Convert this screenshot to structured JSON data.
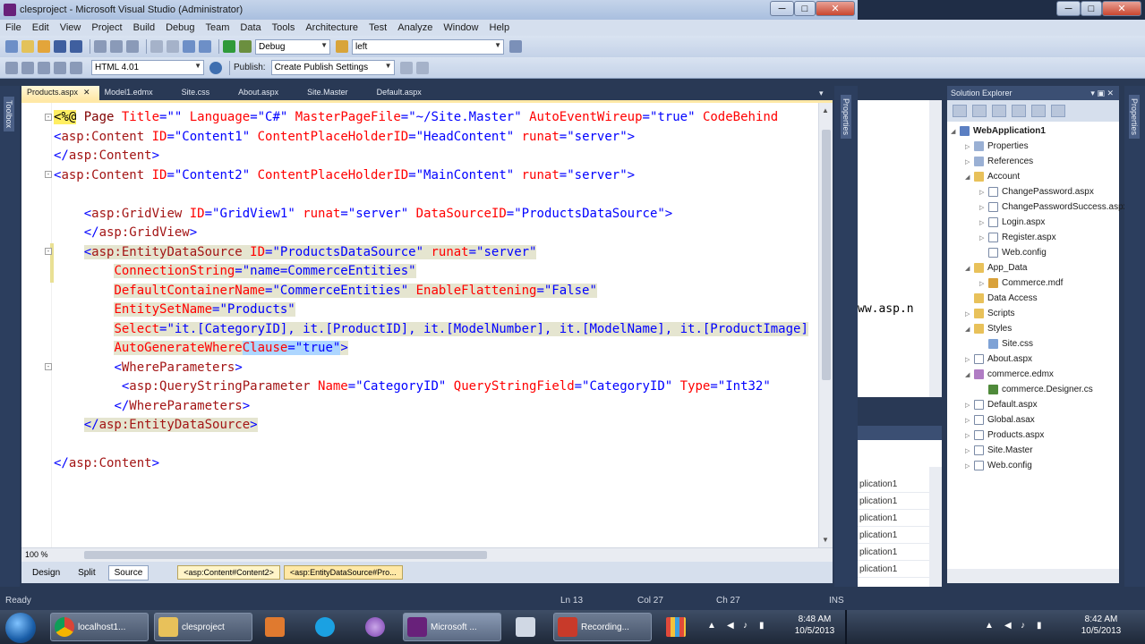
{
  "window": {
    "title": "clesproject - Microsoft Visual Studio (Administrator)",
    "min": "─",
    "max": "□",
    "close": "✕"
  },
  "menu": [
    "File",
    "Edit",
    "View",
    "Project",
    "Build",
    "Debug",
    "Team",
    "Data",
    "Tools",
    "Architecture",
    "Test",
    "Analyze",
    "Window",
    "Help"
  ],
  "toolbar1": {
    "config": "Debug",
    "find": "left"
  },
  "toolbar2": {
    "schema": "HTML 4.01",
    "publish_label": "Publish:",
    "publish_settings": "Create Publish Settings"
  },
  "toolbox_label": "Toolbox",
  "properties_label": "Properties",
  "right_properties_label": "Properties",
  "tabs": [
    {
      "label": "Products.aspx",
      "active": true
    },
    {
      "label": "Model1.edmx"
    },
    {
      "label": "Site.css"
    },
    {
      "label": "About.aspx"
    },
    {
      "label": "Site.Master"
    },
    {
      "label": "Default.aspx"
    }
  ],
  "tab_close": "✕",
  "code_lines": [
    [
      [
        "dir",
        "<%@"
      ],
      [
        "tag",
        " Page "
      ],
      [
        "attr",
        "Title"
      ],
      [
        "blue",
        "=\"\" "
      ],
      [
        "attr",
        "Language"
      ],
      [
        "blue",
        "=\"C#\" "
      ],
      [
        "attr",
        "MasterPageFile"
      ],
      [
        "blue",
        "=\"~/Site.Master\" "
      ],
      [
        "attr",
        "AutoEventWireup"
      ],
      [
        "blue",
        "=\"true\" "
      ],
      [
        "attr",
        "CodeBehind"
      ]
    ],
    [
      [
        "blue",
        "<"
      ],
      [
        "asp",
        "asp:Content"
      ],
      [
        "attr",
        " ID"
      ],
      [
        "blue",
        "=\"Content1\" "
      ],
      [
        "attr",
        "ContentPlaceHolderID"
      ],
      [
        "blue",
        "=\"HeadContent\" "
      ],
      [
        "attr",
        "runat"
      ],
      [
        "blue",
        "=\"server\">"
      ]
    ],
    [
      [
        "blue",
        "</"
      ],
      [
        "asp",
        "asp:Content"
      ],
      [
        "blue",
        ">"
      ]
    ],
    [
      [
        "blue",
        "<"
      ],
      [
        "asp",
        "asp:Content"
      ],
      [
        "attr",
        " ID"
      ],
      [
        "blue",
        "=\"Content2\" "
      ],
      [
        "attr",
        "ContentPlaceHolderID"
      ],
      [
        "blue",
        "=\"MainContent\" "
      ],
      [
        "attr",
        "runat"
      ],
      [
        "blue",
        "=\"server\">"
      ]
    ],
    [
      [
        "plain",
        ""
      ]
    ],
    [
      [
        "plain",
        "    "
      ],
      [
        "blue",
        "<"
      ],
      [
        "asp",
        "asp:GridView"
      ],
      [
        "attr",
        " ID"
      ],
      [
        "blue",
        "=\"GridView1\" "
      ],
      [
        "attr",
        "runat"
      ],
      [
        "blue",
        "=\"server\" "
      ],
      [
        "attr",
        "DataSourceID"
      ],
      [
        "blue",
        "=\"ProductsDataSource\">"
      ]
    ],
    [
      [
        "plain",
        "    "
      ],
      [
        "blue",
        "</"
      ],
      [
        "asp",
        "asp:GridView"
      ],
      [
        "blue",
        ">"
      ]
    ],
    [
      [
        "plain",
        "    "
      ],
      [
        "hlblue",
        "<"
      ],
      [
        "hlasp",
        "asp:EntityDataSource"
      ],
      [
        "hlattr",
        " ID"
      ],
      [
        "hlblue",
        "=\"ProductsDataSource\" "
      ],
      [
        "hlattr",
        "runat"
      ],
      [
        "hlblue",
        "=\"server\""
      ]
    ],
    [
      [
        "plain",
        "        "
      ],
      [
        "hlattr",
        "ConnectionString"
      ],
      [
        "hlblue",
        "=\"name=CommerceEntities\""
      ]
    ],
    [
      [
        "plain",
        "        "
      ],
      [
        "hlattr",
        "DefaultContainerName"
      ],
      [
        "hlblue",
        "=\"CommerceEntities\" "
      ],
      [
        "hlattr",
        "EnableFlattening"
      ],
      [
        "hlblue",
        "=\"False\""
      ]
    ],
    [
      [
        "plain",
        "        "
      ],
      [
        "hlattr",
        "EntitySetName"
      ],
      [
        "hlblue",
        "=\"Products\""
      ]
    ],
    [
      [
        "plain",
        "        "
      ],
      [
        "hlattr",
        "Select"
      ],
      [
        "hlblue",
        "=\"it.[CategoryID], it.[ProductID], it.[ModelNumber], it.[ModelName], it.[ProductImage]"
      ]
    ],
    [
      [
        "plain",
        "        "
      ],
      [
        "hlattr",
        "AutoGenerateWhere"
      ],
      [
        "selattr",
        "Clause"
      ],
      [
        "selblue",
        "=\"true\""
      ],
      [
        "hlblue",
        ">"
      ]
    ],
    [
      [
        "plain",
        "        "
      ],
      [
        "blue",
        "<"
      ],
      [
        "asp",
        "WhereParameters"
      ],
      [
        "blue",
        ">"
      ]
    ],
    [
      [
        "plain",
        "         "
      ],
      [
        "blue",
        "<"
      ],
      [
        "asp",
        "asp:QueryStringParameter"
      ],
      [
        "attr",
        " Name"
      ],
      [
        "blue",
        "=\"CategoryID\" "
      ],
      [
        "attr",
        "QueryStringField"
      ],
      [
        "blue",
        "=\"CategoryID\" "
      ],
      [
        "attr",
        "Type"
      ],
      [
        "blue",
        "=\"Int32\""
      ]
    ],
    [
      [
        "plain",
        "        "
      ],
      [
        "blue",
        "</"
      ],
      [
        "asp",
        "WhereParameters"
      ],
      [
        "blue",
        ">"
      ]
    ],
    [
      [
        "plain",
        "    "
      ],
      [
        "hlblue",
        "</"
      ],
      [
        "hlasp",
        "asp:EntityDataSource"
      ],
      [
        "hlblue",
        ">"
      ]
    ],
    [
      [
        "plain",
        ""
      ]
    ],
    [
      [
        "blue",
        "</"
      ],
      [
        "asp",
        "asp:Content"
      ],
      [
        "blue",
        ">"
      ]
    ]
  ],
  "editor_bottom": {
    "zoom": "100 %",
    "design": "Design",
    "split": "Split",
    "source": "Source",
    "crumb1": "<asp:Content#Content2>",
    "crumb2": "<asp:EntityDataSource#Pro..."
  },
  "mid_panel": {
    "fragment": "ww.asp.n",
    "rows": [
      "plication1",
      "plication1",
      "plication1",
      "plication1",
      "plication1",
      "plication1",
      "plication1"
    ]
  },
  "solution_explorer": {
    "title": "Solution Explorer",
    "controls": "▾ ▣ ✕",
    "items": [
      {
        "label": "WebApplication1",
        "depth": 0,
        "icon": "proj",
        "exp": "◢",
        "bold": true
      },
      {
        "label": "Properties",
        "depth": 1,
        "icon": "ref",
        "exp": "▷"
      },
      {
        "label": "References",
        "depth": 1,
        "icon": "ref",
        "exp": "▷"
      },
      {
        "label": "Account",
        "depth": 1,
        "icon": "folder",
        "exp": "◢"
      },
      {
        "label": "ChangePassword.aspx",
        "depth": 2,
        "icon": "file",
        "exp": "▷"
      },
      {
        "label": "ChangePasswordSuccess.aspx",
        "depth": 2,
        "icon": "file",
        "exp": "▷"
      },
      {
        "label": "Login.aspx",
        "depth": 2,
        "icon": "file",
        "exp": "▷"
      },
      {
        "label": "Register.aspx",
        "depth": 2,
        "icon": "file",
        "exp": "▷"
      },
      {
        "label": "Web.config",
        "depth": 2,
        "icon": "file",
        "exp": ""
      },
      {
        "label": "App_Data",
        "depth": 1,
        "icon": "folder",
        "exp": "◢"
      },
      {
        "label": "Commerce.mdf",
        "depth": 2,
        "icon": "db",
        "exp": "▷"
      },
      {
        "label": "Data Access",
        "depth": 1,
        "icon": "folder",
        "exp": ""
      },
      {
        "label": "Scripts",
        "depth": 1,
        "icon": "folder",
        "exp": "▷"
      },
      {
        "label": "Styles",
        "depth": 1,
        "icon": "folder",
        "exp": "◢"
      },
      {
        "label": "Site.css",
        "depth": 2,
        "icon": "css",
        "exp": ""
      },
      {
        "label": "About.aspx",
        "depth": 1,
        "icon": "file",
        "exp": "▷"
      },
      {
        "label": "commerce.edmx",
        "depth": 1,
        "icon": "edmx",
        "exp": "◢"
      },
      {
        "label": "commerce.Designer.cs",
        "depth": 2,
        "icon": "cs",
        "exp": ""
      },
      {
        "label": "Default.aspx",
        "depth": 1,
        "icon": "file",
        "exp": "▷"
      },
      {
        "label": "Global.asax",
        "depth": 1,
        "icon": "file",
        "exp": "▷"
      },
      {
        "label": "Products.aspx",
        "depth": 1,
        "icon": "file",
        "exp": "▷"
      },
      {
        "label": "Site.Master",
        "depth": 1,
        "icon": "file",
        "exp": "▷"
      },
      {
        "label": "Web.config",
        "depth": 1,
        "icon": "file",
        "exp": "▷"
      }
    ]
  },
  "status": {
    "ready": "Ready",
    "ln": "Ln 13",
    "col": "Col 27",
    "ch": "Ch 27",
    "ins": "INS"
  },
  "taskbar": {
    "apps": [
      {
        "label": "localhost1...",
        "icon": "chrome"
      },
      {
        "label": "clesproject",
        "icon": "folder"
      },
      {
        "label": "",
        "icon": "media"
      },
      {
        "label": "",
        "icon": "skype"
      },
      {
        "label": "",
        "icon": "orb"
      },
      {
        "label": "Microsoft ...",
        "icon": "vs"
      },
      {
        "label": "",
        "icon": "tools"
      },
      {
        "label": "Recording...",
        "icon": "rec"
      },
      {
        "label": "",
        "icon": "grid"
      }
    ],
    "clock1": {
      "time": "8:48 AM",
      "date": "10/5/2013"
    },
    "clock2": {
      "time": "8:42 AM",
      "date": "10/5/2013"
    }
  },
  "colors": {
    "chrome": "#293955",
    "string": "#0000ff",
    "attribute": "#ff0000",
    "element": "#a31515",
    "highlight": "#e5e5d0",
    "selection": "#add6ff"
  }
}
